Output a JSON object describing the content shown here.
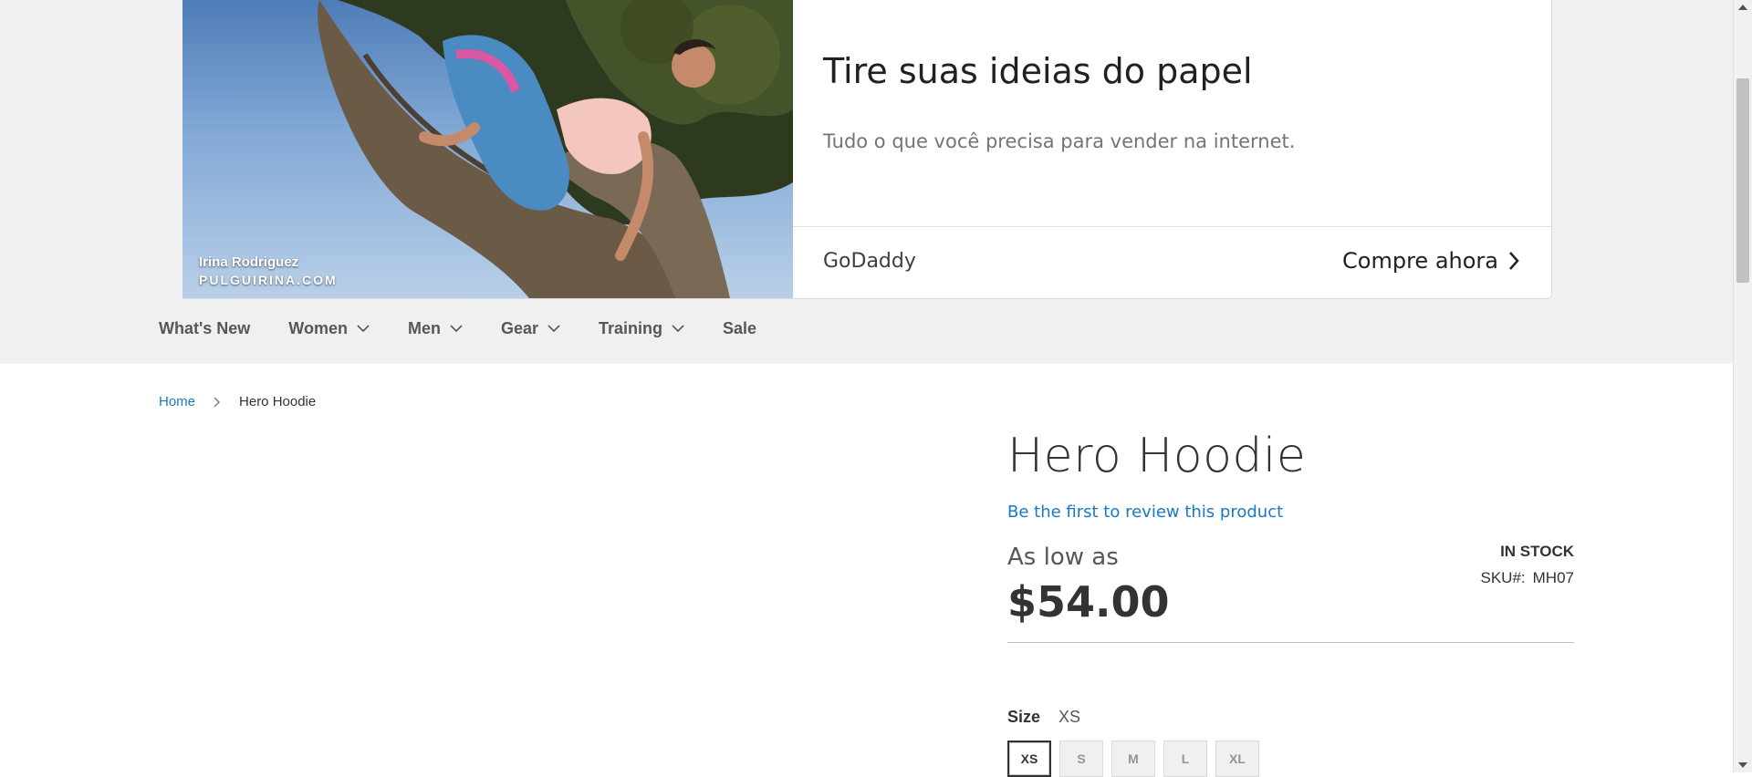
{
  "ad": {
    "photo_name": "Irina Rodriguez",
    "photo_site": "PULGUIRINA.COM",
    "headline": "Tire suas ideias do papel",
    "subtext": "Tudo o que você precisa para vender na internet.",
    "advertiser": "GoDaddy",
    "cta_label": "Compre ahora"
  },
  "nav": {
    "items": [
      {
        "label": "What's New",
        "has_dropdown": false
      },
      {
        "label": "Women",
        "has_dropdown": true
      },
      {
        "label": "Men",
        "has_dropdown": true
      },
      {
        "label": "Gear",
        "has_dropdown": true
      },
      {
        "label": "Training",
        "has_dropdown": true
      },
      {
        "label": "Sale",
        "has_dropdown": false
      }
    ]
  },
  "breadcrumb": {
    "home": "Home",
    "current": "Hero Hoodie"
  },
  "product": {
    "title": "Hero Hoodie",
    "review_link": "Be the first to review this product",
    "price_label": "As low as",
    "price": "$54.00",
    "stock": "In stock",
    "sku_label": "SKU#:",
    "sku": "MH07",
    "size_label": "Size",
    "size_selected": "XS",
    "sizes": [
      "XS",
      "S",
      "M",
      "L",
      "XL"
    ]
  },
  "colors": {
    "link": "#1979c3",
    "nav_background": "#f0f0f0",
    "text": "#333333"
  },
  "icons": {
    "cta": "chevron-right-icon",
    "nav_dropdown": "chevron-down-icon",
    "breadcrumb_separator": "chevron-right-icon"
  }
}
